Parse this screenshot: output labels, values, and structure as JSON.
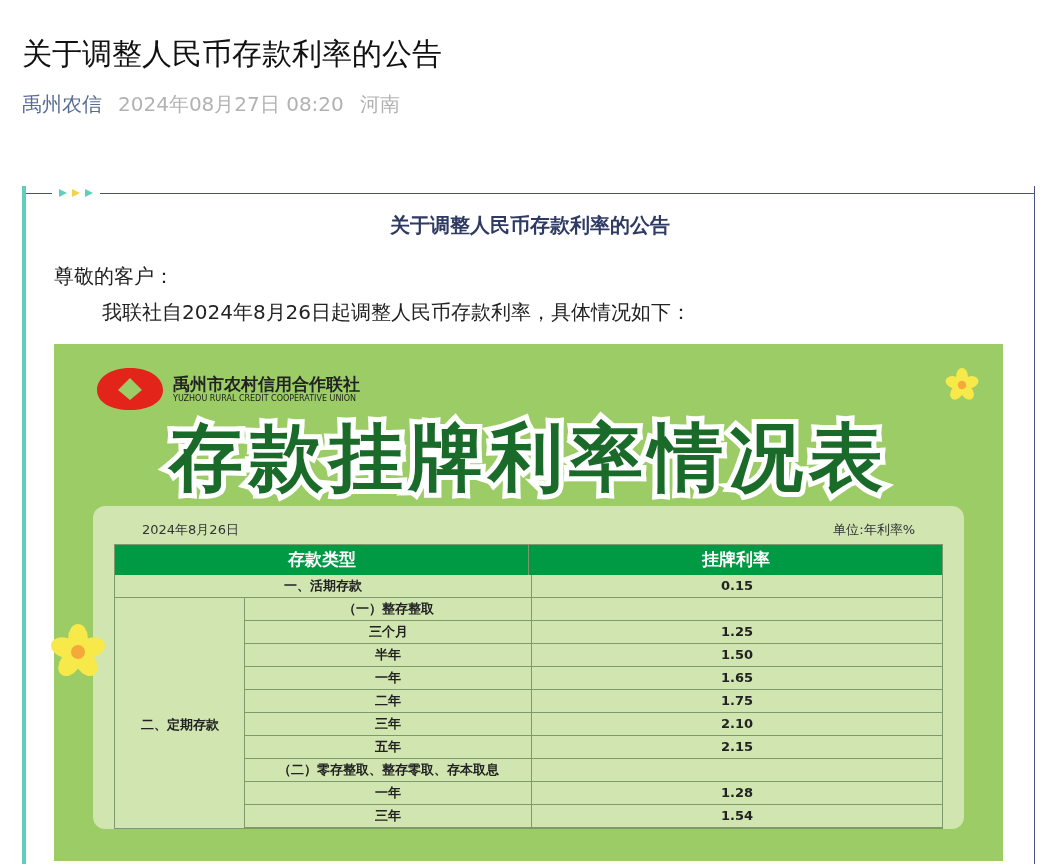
{
  "article": {
    "title": "关于调整人民币存款利率的公告",
    "author": "禹州农信",
    "date": "2024年08月27日 08:20",
    "region": "河南"
  },
  "notice": {
    "title": "关于调整人民币存款利率的公告",
    "salutation": "尊敬的客户：",
    "intro": "我联社自2024年8月26日起调整人民币存款利率，具体情况如下：",
    "poster": {
      "org_name": "禹州市农村信用合作联社",
      "org_name_en": "YUZHOU RURAL CREDIT COOPERATIVE  UNION",
      "title": "存款挂牌利率情况表",
      "date": "2024年8月26日",
      "unit": "单位:年利率%",
      "columns": [
        "存款类型",
        "挂牌利率"
      ],
      "rows": [
        {
          "kind": "full",
          "label": "一、活期存款",
          "rate": "0.15"
        },
        {
          "kind": "group",
          "label": "二、定期存款",
          "children": [
            {
              "kind": "heading",
              "label": "（一）整存整取"
            },
            {
              "kind": "item",
              "label": "三个月",
              "rate": "1.25"
            },
            {
              "kind": "item",
              "label": "半年",
              "rate": "1.50"
            },
            {
              "kind": "item",
              "label": "一年",
              "rate": "1.65"
            },
            {
              "kind": "item",
              "label": "二年",
              "rate": "1.75"
            },
            {
              "kind": "item",
              "label": "三年",
              "rate": "2.10"
            },
            {
              "kind": "item",
              "label": "五年",
              "rate": "2.15"
            },
            {
              "kind": "heading",
              "label": "（二）零存整取、整存零取、存本取息"
            },
            {
              "kind": "item",
              "label": "一年",
              "rate": "1.28"
            },
            {
              "kind": "item",
              "label": "三年",
              "rate": "1.54"
            }
          ]
        }
      ]
    }
  }
}
